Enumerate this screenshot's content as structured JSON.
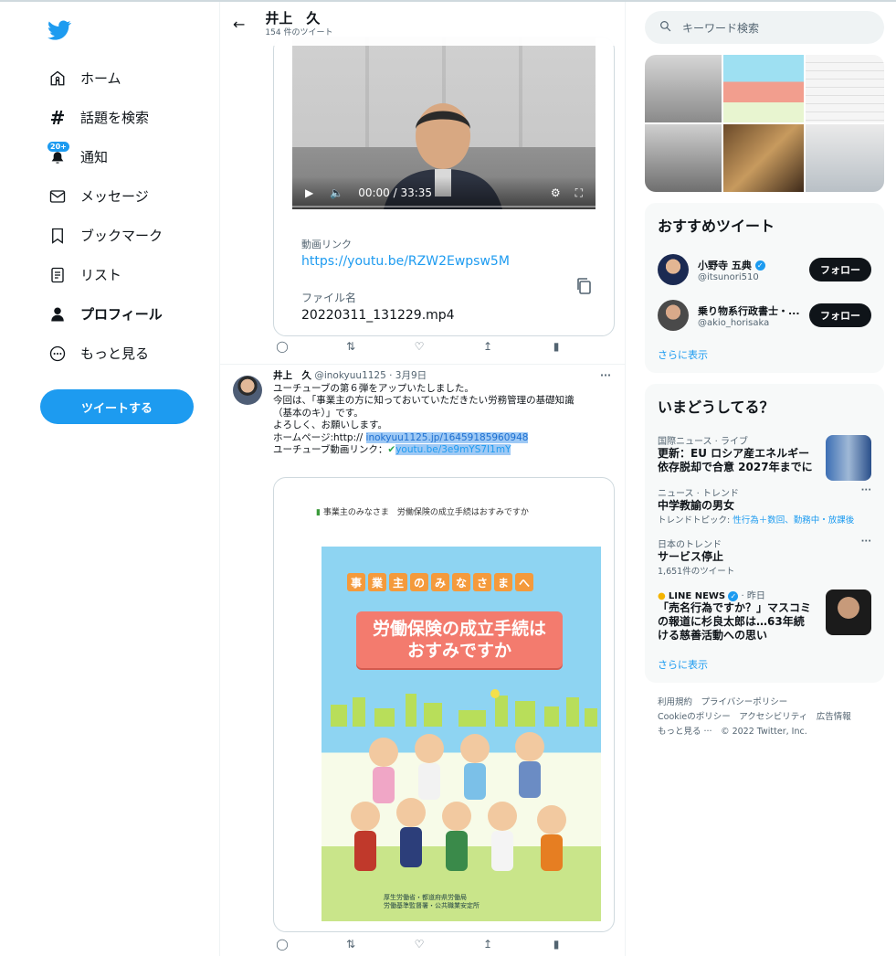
{
  "nav": {
    "items": [
      {
        "label": "ホーム",
        "icon": "home-icon"
      },
      {
        "label": "話題を検索",
        "icon": "hashtag-icon"
      },
      {
        "label": "通知",
        "icon": "bell-icon",
        "badge": "20+"
      },
      {
        "label": "メッセージ",
        "icon": "mail-icon"
      },
      {
        "label": "ブックマーク",
        "icon": "bookmark-icon"
      },
      {
        "label": "リスト",
        "icon": "list-icon"
      },
      {
        "label": "プロフィール",
        "icon": "person-icon"
      },
      {
        "label": "もっと見る",
        "icon": "more-icon"
      }
    ],
    "tweet_button": "ツイートする"
  },
  "header": {
    "name": "井上　久",
    "tweet_count": "154 件のツイート"
  },
  "tweet1": {
    "video_time": "00:00 / 33:35",
    "link_label": "動画リンク",
    "link_url": "https://youtu.be/RZW2Ewpsw5M",
    "file_label": "ファイル名",
    "file_name": "20220311_131229.mp4"
  },
  "tweet2": {
    "name": "井上　久",
    "handle": "@inokyuu1125 · 3月9日",
    "more": "···",
    "lines": [
      "ユーチューブの第６弾をアップいたしました。",
      "今回は、「事業主の方に知っておいていただきたい労務管理の基礎知識",
      "（基本のキ）」です。",
      "よろしく、お願いします。"
    ],
    "homepage_prefix": "ホームページ:http:// ",
    "homepage_link": "inokyuu1125.jp/164591859609​48",
    "youtube_prefix": "ユーチューブ動画リンク：",
    "youtube_link": "youtu.be/3e9mYS7I1mY"
  },
  "poster": {
    "top_text": "事業主のみなさま　労働保険の成立手続はおすみですか",
    "banner": [
      "事",
      "業",
      "主",
      "の",
      "み",
      "な",
      "さ",
      "ま",
      "へ"
    ],
    "main_line1": "労働保険の成立手続は",
    "main_line2": "おすみですか",
    "footer_line1": "厚生労働省・都道府県労働局",
    "footer_line2": "労働基準監督署・公共職業安定所"
  },
  "right": {
    "search_placeholder": "キーワード検索",
    "recommended": {
      "title": "おすすめツイート",
      "users": [
        {
          "name": "小野寺 五典",
          "handle": "@itsunori510",
          "verified": true,
          "follow": "フォロー"
        },
        {
          "name": "乗り物系行政書士・...",
          "handle": "@akio_horisaka",
          "verified": false,
          "follow": "フォロー"
        }
      ],
      "show_more": "さらに表示"
    },
    "trends": {
      "title": "いまどうしてる？",
      "items": [
        {
          "category": "国際ニュース · ライブ",
          "title": "更新：EU ロシア産エネルギー依存脱却で合意 2027年までに"
        },
        {
          "category": "ニュース · トレンド",
          "title": "中学教諭の男女",
          "sub_prefix": "トレンドトピック: ",
          "sub_link": "性行為＋数回、勤務中・放課後"
        },
        {
          "category": "日本のトレンド",
          "title": "サービス停止",
          "sub": "1,651件のツイート"
        },
        {
          "category_source": "LINE NEWS",
          "category_time": " · 昨日",
          "title": "「売名行為ですか？」マスコミの報道に杉良太郎は…63年続ける慈善活動への思い"
        }
      ],
      "show_more": "さらに表示"
    },
    "footer": {
      "line1": "利用規約　プライバシーポリシー",
      "line2": "Cookieのポリシー　アクセシビリティ　広告情報",
      "line3": "もっと見る ···　© 2022 Twitter, Inc."
    }
  },
  "colors": {
    "accent": "#1d9bf0",
    "text": "#0f1419",
    "muted": "#536471"
  }
}
